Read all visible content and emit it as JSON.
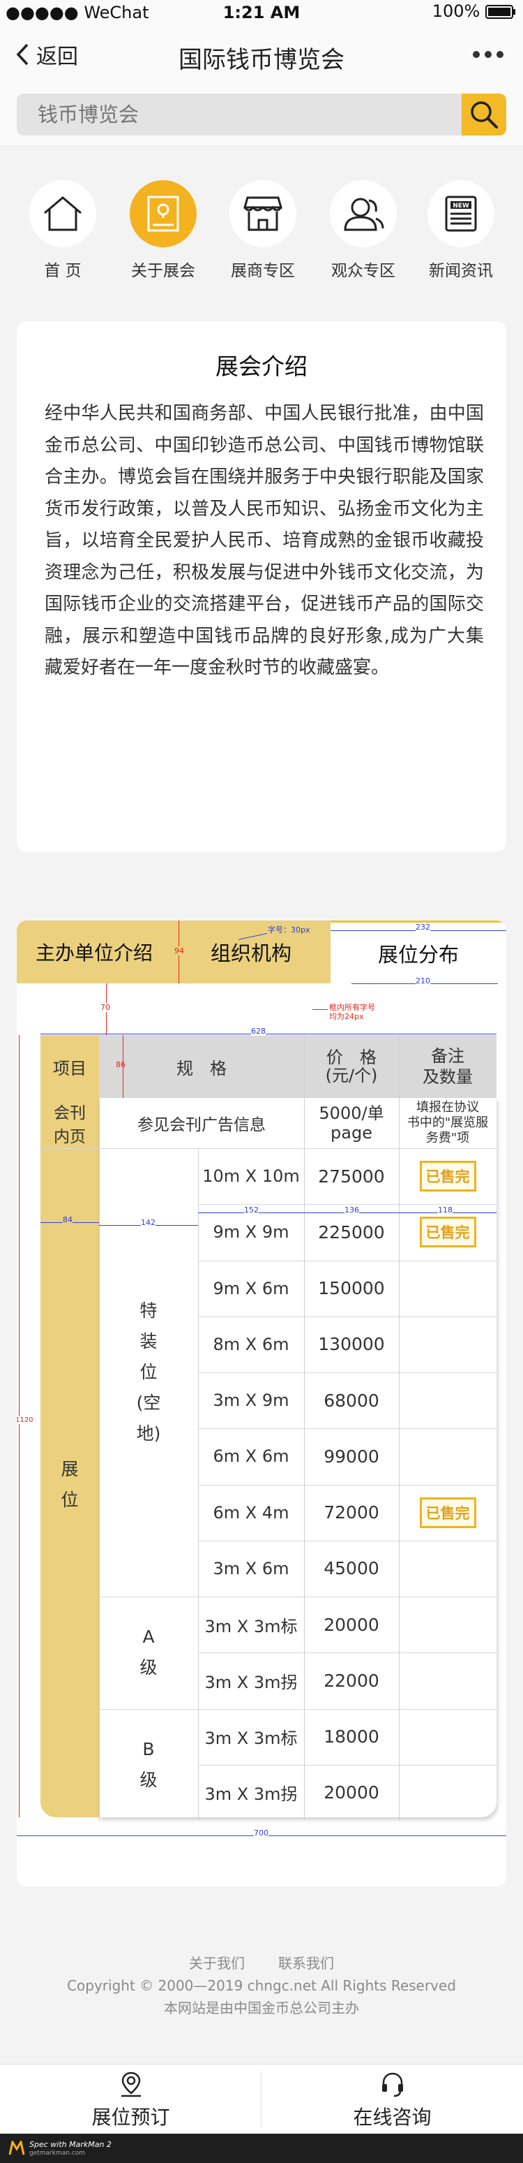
{
  "status_bar": {
    "carrier": "●●●●● WeChat",
    "time": "1:21 AM",
    "battery": "100%"
  },
  "nav": {
    "back_label": "返回",
    "title": "国际钱币博览会"
  },
  "search": {
    "placeholder": "钱币博览会"
  },
  "quick_icons": [
    {
      "label": "首 页",
      "icon": "home-icon"
    },
    {
      "label": "关于展会",
      "icon": "image-icon",
      "active": true
    },
    {
      "label": "展商专区",
      "icon": "store-icon"
    },
    {
      "label": "观众专区",
      "icon": "users-icon"
    },
    {
      "label": "新闻资讯",
      "icon": "news-icon"
    }
  ],
  "intro": {
    "title": "展会介绍",
    "body": "经中华人民共和国商务部、中国人民银行批准，由中国金币总公司、中国印钞造币总公司、中国钱币博物馆联合主办。博览会旨在围绕并服务于中央银行职能及国家货币发行政策，以普及人民币知识、弘扬金币文化为主旨，以培育全民爱护人民币、培育成熟的金银币收藏投资理念为己任，积极发展与促进中外钱币文化交流，为国际钱币企业的交流搭建平台，促进钱币产品的国际交融，展示和塑造中国钱币品牌的良好形象,成为广大集藏爱好者在一年一度金秋时节的收藏盛宴。"
  },
  "tabs": {
    "t1": "主办单位介绍",
    "t2": "组织机构",
    "t3": "展位分布"
  },
  "table": {
    "headers": {
      "item": "项目",
      "spec": "规　格",
      "price": "价　格",
      "price_unit": "(元/个)",
      "note": "备注\n及数量"
    },
    "magazine": {
      "label": "会刊\n内页",
      "spec": "参见会刊广告信息",
      "price": "5000/单\npage",
      "note": "填报在协议\n书中的\"展览服\n务费\"项"
    },
    "booth_label": "展\n\n位",
    "group_special": "特\n装\n位\n(空\n地)",
    "group_a": "A\n\n级",
    "group_b": "B\n\n级",
    "sold_label": "已售完",
    "rows": [
      {
        "spec": "10m X 10m",
        "price": "275000",
        "sold": true
      },
      {
        "spec": "9m X 9m",
        "price": "225000",
        "sold": true
      },
      {
        "spec": "9m X 6m",
        "price": "150000",
        "sold": false
      },
      {
        "spec": "8m X 6m",
        "price": "130000",
        "sold": false
      },
      {
        "spec": "3m X 9m",
        "price": "68000",
        "sold": false
      },
      {
        "spec": "6m X 6m",
        "price": "99000",
        "sold": false
      },
      {
        "spec": "6m X 4m",
        "price": "72000",
        "sold": true
      },
      {
        "spec": "3m X 6m",
        "price": "45000",
        "sold": false
      },
      {
        "spec": "3m X 3m标",
        "price": "20000",
        "sold": false
      },
      {
        "spec": "3m X 3m拐",
        "price": "22000",
        "sold": false
      },
      {
        "spec": "3m X 3m标",
        "price": "18000",
        "sold": false
      },
      {
        "spec": "3m X 3m拐",
        "price": "20000",
        "sold": false
      }
    ]
  },
  "annotations": {
    "font_note": "字号：30px",
    "box_note": "框内所有字号\n均为24px",
    "d94": "94",
    "d232": "232",
    "d210": "210",
    "d70": "70",
    "d628": "628",
    "d86": "86",
    "d84": "84",
    "d142": "142",
    "d152": "152",
    "d136": "136",
    "d118": "118",
    "d1120": "1120",
    "d700": "700"
  },
  "footer": {
    "about": "关于我们",
    "contact": "联系我们",
    "copyright": "Copyright © 2000—2019 chngc.net All Rights Reserved",
    "host": "本网站是由中国金币总公司主办"
  },
  "bottom": {
    "booking": "展位预订",
    "consult": "在线咨询"
  },
  "markman": {
    "line1": "Spec with MarkMan 2",
    "line2": "getmarkman.com"
  },
  "colors": {
    "accent": "#f3b21f",
    "tab_bg": "#ebd07e",
    "annotation_blue": "#2b3fd6",
    "annotation_red": "#e2261f"
  }
}
